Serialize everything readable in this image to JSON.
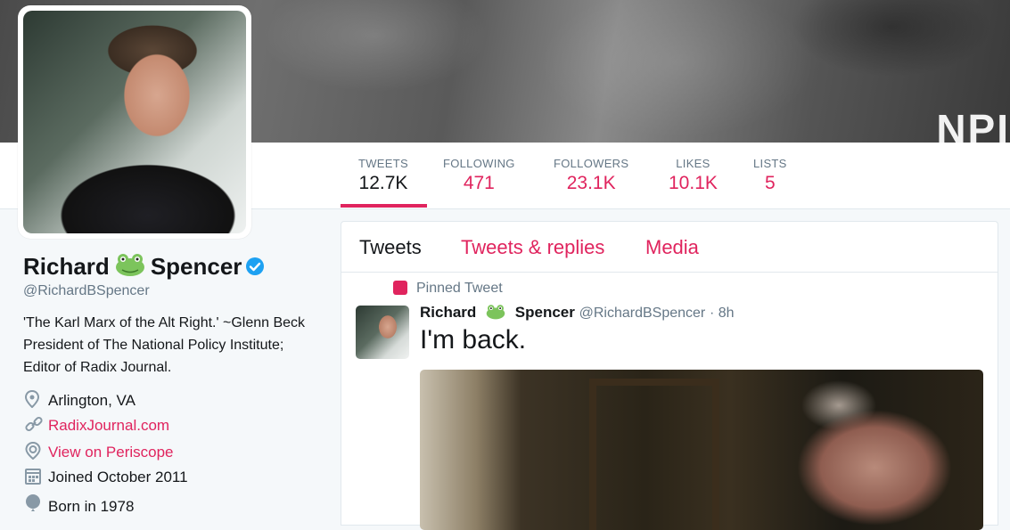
{
  "banner": {
    "text": "NPI"
  },
  "stats": [
    {
      "label": "TWEETS",
      "value": "12.7K",
      "active": true
    },
    {
      "label": "FOLLOWING",
      "value": "471"
    },
    {
      "label": "FOLLOWERS",
      "value": "23.1K"
    },
    {
      "label": "LIKES",
      "value": "10.1K"
    },
    {
      "label": "LISTS",
      "value": "5"
    }
  ],
  "profile": {
    "name_first": "Richard",
    "name_last": "Spencer",
    "handle": "@RichardBSpencer",
    "bio": "'The Karl Marx of the Alt Right.' ~Glenn Beck President of The National Policy Institute; Editor of Radix Journal.",
    "location": "Arlington, VA",
    "website": "RadixJournal.com",
    "periscope": "View on Periscope",
    "joined": "Joined October 2011",
    "born": "Born in 1978"
  },
  "tabs": {
    "tweets": "Tweets",
    "replies": "Tweets & replies",
    "media": "Media"
  },
  "pinned_tweet": {
    "label": "Pinned Tweet",
    "name_first": "Richard",
    "name_last": "Spencer",
    "handle": "@RichardBSpencer",
    "time": "· 8h",
    "text": "I'm back."
  },
  "colors": {
    "accent": "#e0245e",
    "muted": "#657786",
    "verified": "#1da1f2"
  }
}
